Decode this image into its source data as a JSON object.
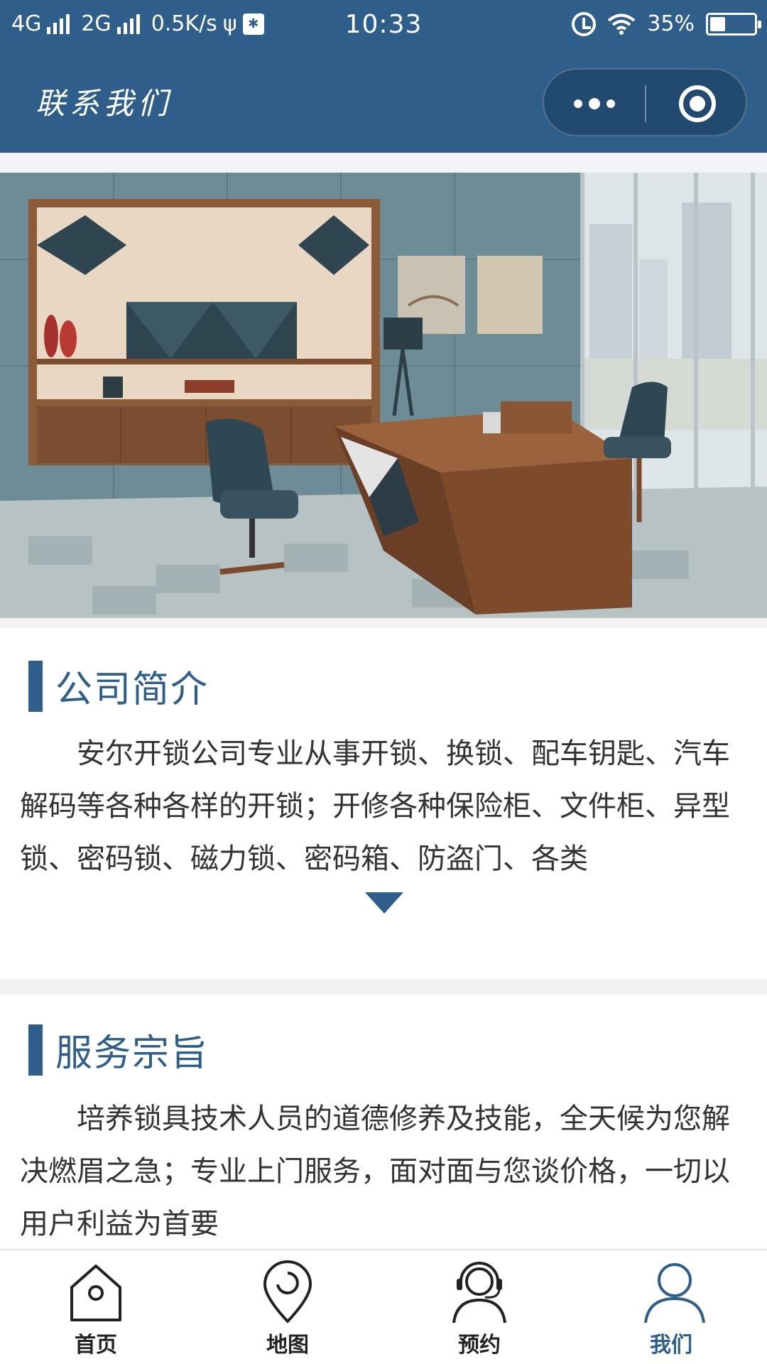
{
  "status_bar": {
    "network_1": "4G",
    "network_2": "2G",
    "speed": "0.5K/s",
    "time": "10:33",
    "battery_text": "35%",
    "battery_level": 0.35,
    "icons": [
      "signal-icon",
      "usb-icon",
      "debug-icon",
      "alarm-icon",
      "wifi-icon",
      "battery-icon"
    ]
  },
  "title_bar": {
    "title": "联系我们",
    "more_icon": "more-dots-icon",
    "close_icon": "target-circle-icon"
  },
  "colors": {
    "brand": "#2f5e8a",
    "background": "#ffffff",
    "separator": "#f2f2f2",
    "text": "#333333"
  },
  "banner": {
    "image": "office-interior-photo"
  },
  "sections": [
    {
      "title": "公司简介",
      "body": "安尔开锁公司专业从事开锁、换锁、配车钥匙、汽车解码等各种各样的开锁；开修各种保险柜、文件柜、异型锁、密码锁、磁力锁、密码箱、防盗门、各类",
      "expand_icon": "triangle-down-icon"
    },
    {
      "title": "服务宗旨",
      "body": "培养锁具技术人员的道德修养及技能，全天候为您解决燃眉之急；专业上门服务，面对面与您谈价格，一切以用户利益为首要"
    }
  ],
  "tabbar": {
    "active": "我们",
    "tabs": [
      {
        "label": "首页",
        "icon": "home-icon"
      },
      {
        "label": "地图",
        "icon": "map-pin-icon"
      },
      {
        "label": "预约",
        "icon": "headset-icon"
      },
      {
        "label": "我们",
        "icon": "user-icon"
      }
    ]
  }
}
